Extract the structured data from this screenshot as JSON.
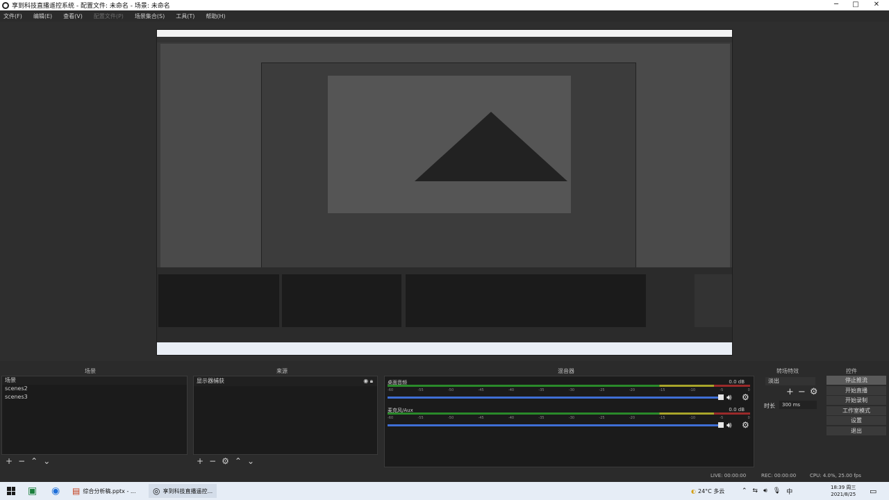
{
  "window": {
    "title": "享到科技直播遥控系统 - 配置文件: 未命名 - 场景: 未命名",
    "minimize_glyph": "─",
    "maximize_glyph": "□",
    "close_glyph": "✕"
  },
  "menu": {
    "items": [
      "文件(F)",
      "编辑(E)",
      "查看(V)",
      "配置文件(P)",
      "场景集合(S)",
      "工具(T)",
      "帮助(H)"
    ]
  },
  "docks": {
    "scenes_title": "场景",
    "sources_title": "来源",
    "mixer_title": "混音器",
    "transitions_title": "转场特效",
    "controls_title": "控件"
  },
  "scenes": {
    "items": [
      "场景",
      "scenes2",
      "scenes3"
    ]
  },
  "sources": {
    "items": [
      "显示器捕获"
    ]
  },
  "mixer": {
    "channels": [
      {
        "name": "桌面音频",
        "db": "0.0 dB"
      },
      {
        "name": "麦克风/Aux",
        "db": "0.0 dB"
      }
    ],
    "ticks": [
      "-60",
      "-55",
      "-50",
      "-45",
      "-40",
      "-35",
      "-30",
      "-25",
      "-20",
      "-15",
      "-10",
      "-5",
      "0"
    ]
  },
  "transitions": {
    "selected": "淡出",
    "duration_label": "时长",
    "duration_value": "300 ms"
  },
  "controls": {
    "buttons": [
      "停止推流",
      "开始直播",
      "开始录制",
      "工作室模式",
      "设置",
      "退出"
    ]
  },
  "status": {
    "live": "LIVE: 00:00:00",
    "rec": "REC: 00:00:00",
    "cpu": "CPU: 4.0%, 25.00 fps"
  },
  "taskbar": {
    "app1": "综合分析稿.pptx - ...",
    "app2": "享到科技直播遥控...",
    "weather": "24°C 多云",
    "ime": "中",
    "time": "18:39 周三",
    "date": "2021/8/25"
  },
  "colors": {
    "panel_bg": "#1b1b1b",
    "window_bg": "#2b2b2b",
    "meter_green": "#2a8a2a",
    "fader_blue": "#3f6fd6"
  }
}
